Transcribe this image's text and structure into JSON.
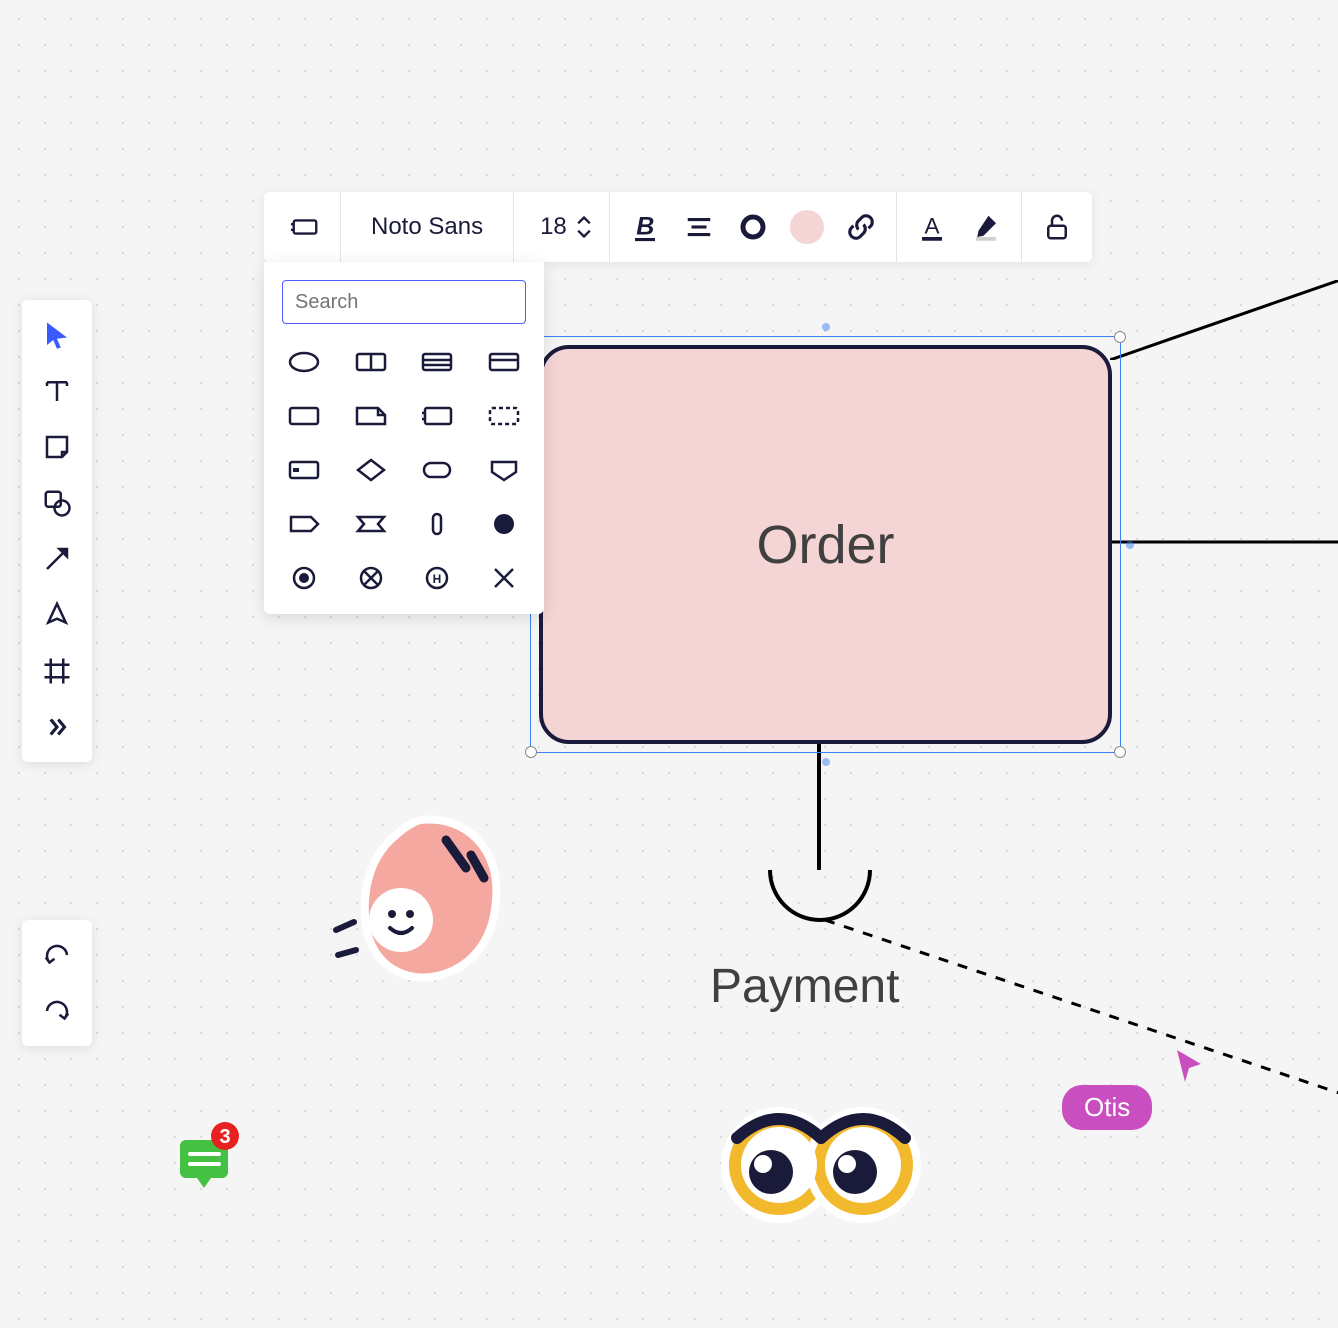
{
  "toolbar": {
    "font_name": "Noto Sans",
    "font_size": "18"
  },
  "shape_picker": {
    "search_placeholder": "Search"
  },
  "canvas": {
    "order_label": "Order",
    "payment_label": "Payment"
  },
  "collaboration": {
    "remote_cursor_name": "Otis",
    "comment_count": "3"
  },
  "colors": {
    "accent_pink": "#f4d4d4",
    "cursor_pink": "#c94fc1",
    "selection_blue": "#3b82f6",
    "ink": "#1a1a3a"
  }
}
